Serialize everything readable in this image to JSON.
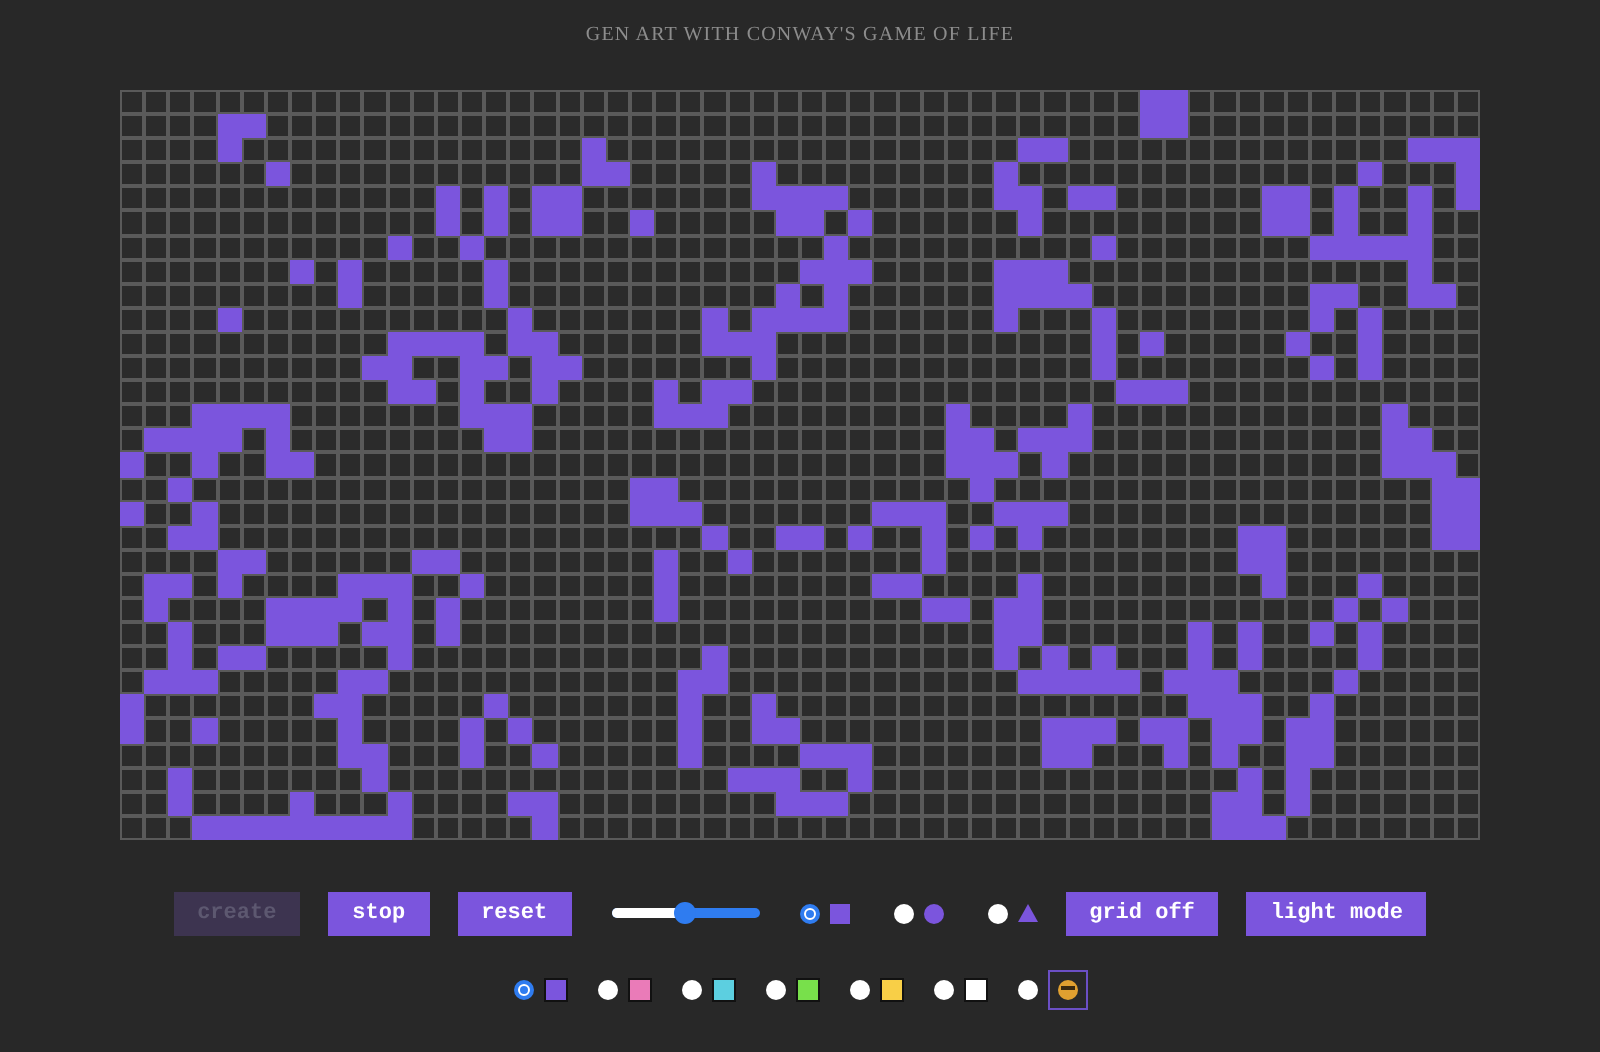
{
  "title": "GEN ART WITH CONWAY'S GAME OF LIFE",
  "grid": {
    "rows": [
      [
        false,
        false,
        false,
        false,
        false,
        false,
        false,
        false,
        false,
        false,
        false,
        false,
        false,
        false,
        false,
        false,
        false,
        false,
        false,
        false,
        false,
        false,
        false,
        false,
        false,
        false,
        false,
        false,
        false,
        false,
        false,
        false,
        false,
        false,
        false,
        false,
        false,
        false,
        false,
        false,
        false,
        false,
        true,
        true,
        false,
        false,
        false,
        false,
        false,
        false,
        false,
        false,
        false,
        false,
        false,
        false
      ],
      [
        false,
        false,
        false,
        false,
        true,
        true,
        false,
        false,
        false,
        false,
        false,
        false,
        false,
        false,
        false,
        false,
        false,
        false,
        false,
        false,
        false,
        false,
        false,
        false,
        false,
        false,
        false,
        false,
        false,
        false,
        false,
        false,
        false,
        false,
        false,
        false,
        false,
        false,
        false,
        false,
        false,
        false,
        true,
        true,
        false,
        false,
        false,
        false,
        false,
        false,
        false,
        false,
        false,
        false,
        false,
        false
      ],
      [
        false,
        false,
        false,
        false,
        true,
        false,
        false,
        false,
        false,
        false,
        false,
        false,
        false,
        false,
        false,
        false,
        false,
        false,
        false,
        true,
        false,
        false,
        false,
        false,
        false,
        false,
        false,
        false,
        false,
        false,
        false,
        false,
        false,
        false,
        false,
        false,
        false,
        true,
        true,
        false,
        false,
        false,
        false,
        false,
        false,
        false,
        false,
        false,
        false,
        false,
        false,
        false,
        false,
        true,
        true,
        true
      ],
      [
        false,
        false,
        false,
        false,
        false,
        false,
        true,
        false,
        false,
        false,
        false,
        false,
        false,
        false,
        false,
        false,
        false,
        false,
        false,
        true,
        true,
        false,
        false,
        false,
        false,
        false,
        true,
        false,
        false,
        false,
        false,
        false,
        false,
        false,
        false,
        false,
        true,
        false,
        false,
        false,
        false,
        false,
        false,
        false,
        false,
        false,
        false,
        false,
        false,
        false,
        false,
        true,
        false,
        false,
        false,
        true
      ],
      [
        false,
        false,
        false,
        false,
        false,
        false,
        false,
        false,
        false,
        false,
        false,
        false,
        false,
        true,
        false,
        true,
        false,
        true,
        true,
        false,
        false,
        false,
        false,
        false,
        false,
        false,
        true,
        true,
        true,
        true,
        false,
        false,
        false,
        false,
        false,
        false,
        true,
        true,
        false,
        true,
        true,
        false,
        false,
        false,
        false,
        false,
        false,
        true,
        true,
        false,
        true,
        false,
        false,
        true,
        false,
        true
      ],
      [
        false,
        false,
        false,
        false,
        false,
        false,
        false,
        false,
        false,
        false,
        false,
        false,
        false,
        true,
        false,
        true,
        false,
        true,
        true,
        false,
        false,
        true,
        false,
        false,
        false,
        false,
        false,
        true,
        true,
        false,
        true,
        false,
        false,
        false,
        false,
        false,
        false,
        true,
        false,
        false,
        false,
        false,
        false,
        false,
        false,
        false,
        false,
        true,
        true,
        false,
        true,
        false,
        false,
        true,
        false,
        false
      ],
      [
        false,
        false,
        false,
        false,
        false,
        false,
        false,
        false,
        false,
        false,
        false,
        true,
        false,
        false,
        true,
        false,
        false,
        false,
        false,
        false,
        false,
        false,
        false,
        false,
        false,
        false,
        false,
        false,
        false,
        true,
        false,
        false,
        false,
        false,
        false,
        false,
        false,
        false,
        false,
        false,
        true,
        false,
        false,
        false,
        false,
        false,
        false,
        false,
        false,
        true,
        true,
        true,
        true,
        true,
        false,
        false
      ],
      [
        false,
        false,
        false,
        false,
        false,
        false,
        false,
        true,
        false,
        true,
        false,
        false,
        false,
        false,
        false,
        true,
        false,
        false,
        false,
        false,
        false,
        false,
        false,
        false,
        false,
        false,
        false,
        false,
        true,
        true,
        true,
        false,
        false,
        false,
        false,
        false,
        true,
        true,
        true,
        false,
        false,
        false,
        false,
        false,
        false,
        false,
        false,
        false,
        false,
        false,
        false,
        false,
        false,
        true,
        false,
        false
      ],
      [
        false,
        false,
        false,
        false,
        false,
        false,
        false,
        false,
        false,
        true,
        false,
        false,
        false,
        false,
        false,
        true,
        false,
        false,
        false,
        false,
        false,
        false,
        false,
        false,
        false,
        false,
        false,
        true,
        false,
        true,
        false,
        false,
        false,
        false,
        false,
        false,
        true,
        true,
        true,
        true,
        false,
        false,
        false,
        false,
        false,
        false,
        false,
        false,
        false,
        true,
        true,
        false,
        false,
        true,
        true,
        false
      ],
      [
        false,
        false,
        false,
        false,
        true,
        false,
        false,
        false,
        false,
        false,
        false,
        false,
        false,
        false,
        false,
        false,
        true,
        false,
        false,
        false,
        false,
        false,
        false,
        false,
        true,
        false,
        true,
        true,
        true,
        true,
        false,
        false,
        false,
        false,
        false,
        false,
        true,
        false,
        false,
        false,
        true,
        false,
        false,
        false,
        false,
        false,
        false,
        false,
        false,
        true,
        false,
        true,
        false,
        false,
        false,
        false
      ],
      [
        false,
        false,
        false,
        false,
        false,
        false,
        false,
        false,
        false,
        false,
        false,
        true,
        true,
        true,
        true,
        false,
        true,
        true,
        false,
        false,
        false,
        false,
        false,
        false,
        true,
        true,
        true,
        false,
        false,
        false,
        false,
        false,
        false,
        false,
        false,
        false,
        false,
        false,
        false,
        false,
        true,
        false,
        true,
        false,
        false,
        false,
        false,
        false,
        true,
        false,
        false,
        true,
        false,
        false,
        false,
        false
      ],
      [
        false,
        false,
        false,
        false,
        false,
        false,
        false,
        false,
        false,
        false,
        true,
        true,
        false,
        false,
        true,
        true,
        false,
        true,
        true,
        false,
        false,
        false,
        false,
        false,
        false,
        false,
        true,
        false,
        false,
        false,
        false,
        false,
        false,
        false,
        false,
        false,
        false,
        false,
        false,
        false,
        true,
        false,
        false,
        false,
        false,
        false,
        false,
        false,
        false,
        true,
        false,
        true,
        false,
        false,
        false,
        false
      ],
      [
        false,
        false,
        false,
        false,
        false,
        false,
        false,
        false,
        false,
        false,
        false,
        true,
        true,
        false,
        true,
        false,
        false,
        true,
        false,
        false,
        false,
        false,
        true,
        false,
        true,
        true,
        false,
        false,
        false,
        false,
        false,
        false,
        false,
        false,
        false,
        false,
        false,
        false,
        false,
        false,
        false,
        true,
        true,
        true,
        false,
        false,
        false,
        false,
        false,
        false,
        false,
        false,
        false,
        false,
        false,
        false
      ],
      [
        false,
        false,
        false,
        true,
        true,
        true,
        true,
        false,
        false,
        false,
        false,
        false,
        false,
        false,
        true,
        true,
        true,
        false,
        false,
        false,
        false,
        false,
        true,
        true,
        true,
        false,
        false,
        false,
        false,
        false,
        false,
        false,
        false,
        false,
        true,
        false,
        false,
        false,
        false,
        true,
        false,
        false,
        false,
        false,
        false,
        false,
        false,
        false,
        false,
        false,
        false,
        false,
        true,
        false,
        false,
        false
      ],
      [
        false,
        true,
        true,
        true,
        true,
        false,
        true,
        false,
        false,
        false,
        false,
        false,
        false,
        false,
        false,
        true,
        true,
        false,
        false,
        false,
        false,
        false,
        false,
        false,
        false,
        false,
        false,
        false,
        false,
        false,
        false,
        false,
        false,
        false,
        true,
        true,
        false,
        true,
        true,
        true,
        false,
        false,
        false,
        false,
        false,
        false,
        false,
        false,
        false,
        false,
        false,
        false,
        true,
        true,
        false,
        false
      ],
      [
        true,
        false,
        false,
        true,
        false,
        false,
        true,
        true,
        false,
        false,
        false,
        false,
        false,
        false,
        false,
        false,
        false,
        false,
        false,
        false,
        false,
        false,
        false,
        false,
        false,
        false,
        false,
        false,
        false,
        false,
        false,
        false,
        false,
        false,
        true,
        true,
        true,
        false,
        true,
        false,
        false,
        false,
        false,
        false,
        false,
        false,
        false,
        false,
        false,
        false,
        false,
        false,
        true,
        true,
        true,
        false
      ],
      [
        false,
        false,
        true,
        false,
        false,
        false,
        false,
        false,
        false,
        false,
        false,
        false,
        false,
        false,
        false,
        false,
        false,
        false,
        false,
        false,
        false,
        true,
        true,
        false,
        false,
        false,
        false,
        false,
        false,
        false,
        false,
        false,
        false,
        false,
        false,
        true,
        false,
        false,
        false,
        false,
        false,
        false,
        false,
        false,
        false,
        false,
        false,
        false,
        false,
        false,
        false,
        false,
        false,
        false,
        true,
        true
      ],
      [
        true,
        false,
        false,
        true,
        false,
        false,
        false,
        false,
        false,
        false,
        false,
        false,
        false,
        false,
        false,
        false,
        false,
        false,
        false,
        false,
        false,
        true,
        true,
        true,
        false,
        false,
        false,
        false,
        false,
        false,
        false,
        true,
        true,
        true,
        false,
        false,
        true,
        true,
        true,
        false,
        false,
        false,
        false,
        false,
        false,
        false,
        false,
        false,
        false,
        false,
        false,
        false,
        false,
        false,
        true,
        true
      ],
      [
        false,
        false,
        true,
        true,
        false,
        false,
        false,
        false,
        false,
        false,
        false,
        false,
        false,
        false,
        false,
        false,
        false,
        false,
        false,
        false,
        false,
        false,
        false,
        false,
        true,
        false,
        false,
        true,
        true,
        false,
        true,
        false,
        false,
        true,
        false,
        true,
        false,
        true,
        false,
        false,
        false,
        false,
        false,
        false,
        false,
        false,
        true,
        true,
        false,
        false,
        false,
        false,
        false,
        false,
        true,
        true
      ],
      [
        false,
        false,
        false,
        false,
        true,
        true,
        false,
        false,
        false,
        false,
        false,
        false,
        true,
        true,
        false,
        false,
        false,
        false,
        false,
        false,
        false,
        false,
        true,
        false,
        false,
        true,
        false,
        false,
        false,
        false,
        false,
        false,
        false,
        true,
        false,
        false,
        false,
        false,
        false,
        false,
        false,
        false,
        false,
        false,
        false,
        false,
        true,
        true,
        false,
        false,
        false,
        false,
        false,
        false,
        false,
        false
      ],
      [
        false,
        true,
        true,
        false,
        true,
        false,
        false,
        false,
        false,
        true,
        true,
        true,
        false,
        false,
        true,
        false,
        false,
        false,
        false,
        false,
        false,
        false,
        true,
        false,
        false,
        false,
        false,
        false,
        false,
        false,
        false,
        true,
        true,
        false,
        false,
        false,
        false,
        true,
        false,
        false,
        false,
        false,
        false,
        false,
        false,
        false,
        false,
        true,
        false,
        false,
        false,
        true,
        false,
        false,
        false,
        false
      ],
      [
        false,
        true,
        false,
        false,
        false,
        false,
        true,
        true,
        true,
        true,
        false,
        true,
        false,
        true,
        false,
        false,
        false,
        false,
        false,
        false,
        false,
        false,
        true,
        false,
        false,
        false,
        false,
        false,
        false,
        false,
        false,
        false,
        false,
        true,
        true,
        false,
        true,
        true,
        false,
        false,
        false,
        false,
        false,
        false,
        false,
        false,
        false,
        false,
        false,
        false,
        true,
        false,
        true,
        false,
        false,
        false
      ],
      [
        false,
        false,
        true,
        false,
        false,
        false,
        true,
        true,
        true,
        false,
        true,
        true,
        false,
        true,
        false,
        false,
        false,
        false,
        false,
        false,
        false,
        false,
        false,
        false,
        false,
        false,
        false,
        false,
        false,
        false,
        false,
        false,
        false,
        false,
        false,
        false,
        true,
        true,
        false,
        false,
        false,
        false,
        false,
        false,
        true,
        false,
        true,
        false,
        false,
        true,
        false,
        true,
        false,
        false,
        false,
        false
      ],
      [
        false,
        false,
        true,
        false,
        true,
        true,
        false,
        false,
        false,
        false,
        false,
        true,
        false,
        false,
        false,
        false,
        false,
        false,
        false,
        false,
        false,
        false,
        false,
        false,
        true,
        false,
        false,
        false,
        false,
        false,
        false,
        false,
        false,
        false,
        false,
        false,
        true,
        false,
        true,
        false,
        true,
        false,
        false,
        false,
        true,
        false,
        true,
        false,
        false,
        false,
        false,
        true,
        false,
        false,
        false,
        false
      ],
      [
        false,
        true,
        true,
        true,
        false,
        false,
        false,
        false,
        false,
        true,
        true,
        false,
        false,
        false,
        false,
        false,
        false,
        false,
        false,
        false,
        false,
        false,
        false,
        true,
        true,
        false,
        false,
        false,
        false,
        false,
        false,
        false,
        false,
        false,
        false,
        false,
        false,
        true,
        true,
        true,
        true,
        true,
        false,
        true,
        true,
        true,
        false,
        false,
        false,
        false,
        true,
        false,
        false,
        false,
        false,
        false
      ],
      [
        true,
        false,
        false,
        false,
        false,
        false,
        false,
        false,
        true,
        true,
        false,
        false,
        false,
        false,
        false,
        true,
        false,
        false,
        false,
        false,
        false,
        false,
        false,
        true,
        false,
        false,
        true,
        false,
        false,
        false,
        false,
        false,
        false,
        false,
        false,
        false,
        false,
        false,
        false,
        false,
        false,
        false,
        false,
        false,
        true,
        true,
        true,
        false,
        false,
        true,
        false,
        false,
        false,
        false,
        false,
        false
      ],
      [
        true,
        false,
        false,
        true,
        false,
        false,
        false,
        false,
        false,
        true,
        false,
        false,
        false,
        false,
        true,
        false,
        true,
        false,
        false,
        false,
        false,
        false,
        false,
        true,
        false,
        false,
        true,
        true,
        false,
        false,
        false,
        false,
        false,
        false,
        false,
        false,
        false,
        false,
        true,
        true,
        true,
        false,
        true,
        true,
        false,
        true,
        true,
        false,
        true,
        true,
        false,
        false,
        false,
        false,
        false,
        false
      ],
      [
        false,
        false,
        false,
        false,
        false,
        false,
        false,
        false,
        false,
        true,
        true,
        false,
        false,
        false,
        true,
        false,
        false,
        true,
        false,
        false,
        false,
        false,
        false,
        true,
        false,
        false,
        false,
        false,
        true,
        true,
        true,
        false,
        false,
        false,
        false,
        false,
        false,
        false,
        true,
        true,
        false,
        false,
        false,
        true,
        false,
        true,
        false,
        false,
        true,
        true,
        false,
        false,
        false,
        false,
        false,
        false
      ],
      [
        false,
        false,
        true,
        false,
        false,
        false,
        false,
        false,
        false,
        false,
        true,
        false,
        false,
        false,
        false,
        false,
        false,
        false,
        false,
        false,
        false,
        false,
        false,
        false,
        false,
        true,
        true,
        true,
        false,
        false,
        true,
        false,
        false,
        false,
        false,
        false,
        false,
        false,
        false,
        false,
        false,
        false,
        false,
        false,
        false,
        false,
        true,
        false,
        true,
        false,
        false,
        false,
        false,
        false,
        false,
        false
      ],
      [
        false,
        false,
        true,
        false,
        false,
        false,
        false,
        true,
        false,
        false,
        false,
        true,
        false,
        false,
        false,
        false,
        true,
        true,
        false,
        false,
        false,
        false,
        false,
        false,
        false,
        false,
        false,
        true,
        true,
        true,
        false,
        false,
        false,
        false,
        false,
        false,
        false,
        false,
        false,
        false,
        false,
        false,
        false,
        false,
        false,
        true,
        true,
        false,
        true,
        false,
        false,
        false,
        false,
        false,
        false,
        false
      ],
      [
        false,
        false,
        false,
        true,
        true,
        true,
        true,
        true,
        true,
        true,
        true,
        true,
        false,
        false,
        false,
        false,
        false,
        true,
        false,
        false,
        false,
        false,
        false,
        false,
        false,
        false,
        false,
        false,
        false,
        false,
        false,
        false,
        false,
        false,
        false,
        false,
        false,
        false,
        false,
        false,
        false,
        false,
        false,
        false,
        false,
        true,
        true,
        true,
        false,
        false,
        false,
        false,
        false,
        false,
        false,
        false
      ]
    ]
  },
  "controls": [
    {
      "kind": "button",
      "label": "create",
      "disabled": true
    },
    {
      "kind": "button",
      "label": "stop",
      "disabled": false
    },
    {
      "kind": "button",
      "label": "reset",
      "disabled": false
    },
    {
      "kind": "slider",
      "level": 0.5
    },
    {
      "kind": "shapes",
      "options": [
        {
          "kind": "square",
          "selected": true
        },
        {
          "kind": "circle",
          "selected": false
        },
        {
          "kind": "triangle",
          "selected": false
        }
      ]
    },
    {
      "kind": "button",
      "label": "grid off",
      "disabled": false
    },
    {
      "kind": "button",
      "label": "light mode",
      "disabled": false
    }
  ],
  "colors": [
    {
      "kind": "swatch",
      "color": "#7b55dd",
      "selected": true
    },
    {
      "kind": "swatch",
      "color": "#ea7bb8",
      "selected": false
    },
    {
      "kind": "swatch",
      "color": "#5ccfe0",
      "selected": false
    },
    {
      "kind": "swatch",
      "color": "#78e04b",
      "selected": false
    },
    {
      "kind": "swatch",
      "color": "#f8cf47",
      "selected": false
    },
    {
      "kind": "swatch",
      "color": "#ffffff",
      "selected": false
    },
    {
      "kind": "emoji",
      "selected": false
    }
  ]
}
